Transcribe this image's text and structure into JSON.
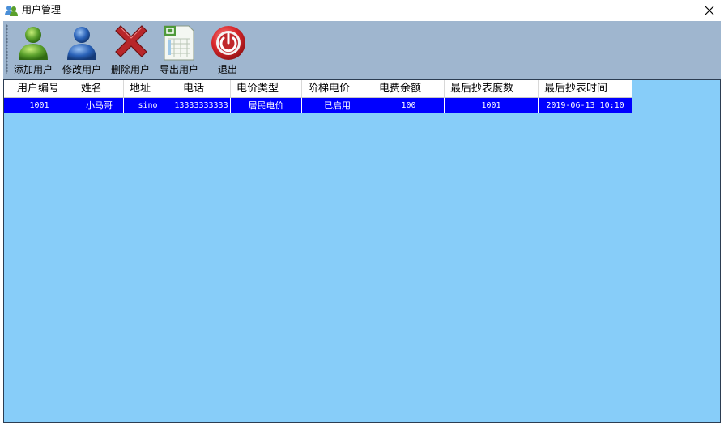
{
  "window": {
    "title": "用户管理",
    "icon": "users-icon",
    "close_icon": "close-icon"
  },
  "toolbar": {
    "buttons": [
      {
        "label": "添加用户",
        "icon": "add-user-icon"
      },
      {
        "label": "修改用户",
        "icon": "edit-user-icon"
      },
      {
        "label": "删除用户",
        "icon": "delete-cross-icon"
      },
      {
        "label": "导出用户",
        "icon": "spreadsheet-export-icon"
      },
      {
        "label": "退出",
        "icon": "power-icon"
      }
    ]
  },
  "grid": {
    "columns": [
      "用户编号",
      "姓名",
      "地址",
      "电话",
      "电价类型",
      "阶梯电价",
      "电费余额",
      "最后抄表度数",
      "最后抄表时间"
    ],
    "rows": [
      {
        "id": "1001",
        "name": "小马哥",
        "address": "sino",
        "phone": "13333333333",
        "price_type": "居民电价",
        "tiered_price": "已启用",
        "balance": "100",
        "last_reading": "1001",
        "last_reading_time": "2019-06-13 10:10"
      }
    ],
    "selected_row_color": "#0000ff",
    "background_color": "#87cdf9"
  },
  "colors": {
    "toolbar": "#9fb6cf",
    "accent_red": "#c0282c",
    "user_green": "#5aa02c",
    "user_blue": "#2a62b8"
  }
}
